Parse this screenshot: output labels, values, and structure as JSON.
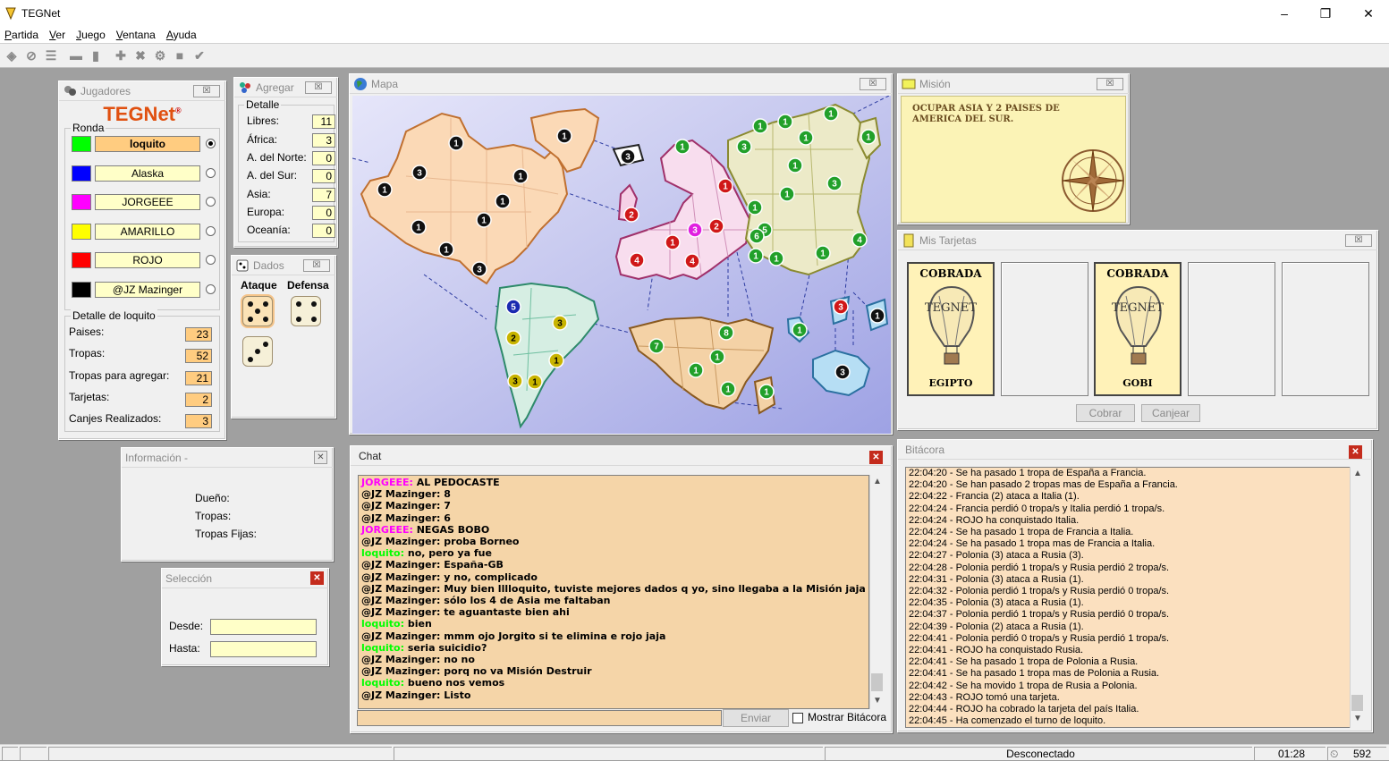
{
  "window": {
    "title": "TEGNet"
  },
  "menu": [
    "Partida",
    "Ver",
    "Juego",
    "Ventana",
    "Ayuda"
  ],
  "jugadores": {
    "title": "Jugadores",
    "logo": "TEGNet",
    "ronda_label": "Ronda",
    "players": [
      {
        "name": "loquito",
        "color": "#00ff00",
        "selected": true
      },
      {
        "name": "Alaska",
        "color": "#0000ff",
        "selected": false
      },
      {
        "name": "JORGEEE",
        "color": "#ff00ff",
        "selected": false
      },
      {
        "name": "AMARILLO",
        "color": "#ffff00",
        "selected": false
      },
      {
        "name": "ROJO",
        "color": "#ff0000",
        "selected": false
      },
      {
        "name": "@JZ Mazinger",
        "color": "#000000",
        "selected": false
      }
    ],
    "detalle_label": "Detalle de loquito",
    "detalle": [
      {
        "label": "Paises:",
        "value": "23"
      },
      {
        "label": "Tropas:",
        "value": "52"
      },
      {
        "label": "Tropas para agregar:",
        "value": "21"
      },
      {
        "label": "Tarjetas:",
        "value": "2"
      },
      {
        "label": "Canjes Realizados:",
        "value": "3"
      }
    ]
  },
  "agregar": {
    "title": "Agregar",
    "detalle_label": "Detalle",
    "rows": [
      {
        "label": "Libres:",
        "value": "11"
      },
      {
        "label": "África:",
        "value": "3"
      },
      {
        "label": "A. del Norte:",
        "value": "0"
      },
      {
        "label": "A. del Sur:",
        "value": "0"
      },
      {
        "label": "Asia:",
        "value": "7"
      },
      {
        "label": "Europa:",
        "value": "0"
      },
      {
        "label": "Oceanía:",
        "value": "0"
      }
    ]
  },
  "dados": {
    "title": "Dados",
    "ataque": "Ataque",
    "defensa": "Defensa"
  },
  "mapa": {
    "title": "Mapa"
  },
  "mision": {
    "title": "Misión",
    "text": "OCUPAR ASIA Y 2 PAISES DE AMERICA DEL SUR."
  },
  "tarjetas": {
    "title": "Mis Tarjetas",
    "cards": [
      {
        "top": "COBRADA",
        "bottom": "EGIPTO",
        "brand": "TEGNET"
      },
      {
        "top": "COBRADA",
        "bottom": "GOBI",
        "brand": "TEGNET"
      }
    ],
    "cobrar": "Cobrar",
    "canjear": "Canjear"
  },
  "informacion": {
    "title": "Información -",
    "dueno": "Dueño:",
    "tropas": "Tropas:",
    "tropas_fijas": "Tropas Fijas:"
  },
  "seleccion": {
    "title": "Selección",
    "desde": "Desde:",
    "hasta": "Hasta:"
  },
  "chat": {
    "title": "Chat",
    "enviar": "Enviar",
    "mostrar_bitacora": "Mostrar Bitácora",
    "messages": [
      {
        "user": "JORGEEE:",
        "text": " AL PEDOCASTE",
        "color": "#ff00ff"
      },
      {
        "user": "@JZ Mazinger:",
        "text": " 8",
        "color": "#000000"
      },
      {
        "user": "@JZ Mazinger:",
        "text": " 7",
        "color": "#000000"
      },
      {
        "user": "@JZ Mazinger:",
        "text": " 6",
        "color": "#000000"
      },
      {
        "user": "JORGEEE:",
        "text": " NEGAS BOBO",
        "color": "#ff00ff"
      },
      {
        "user": "@JZ Mazinger:",
        "text": " proba Borneo",
        "color": "#000000"
      },
      {
        "user": "loquito:",
        "text": " no, pero ya fue",
        "color": "#00ff00"
      },
      {
        "user": "@JZ Mazinger:",
        "text": " España-GB",
        "color": "#000000"
      },
      {
        "user": "@JZ Mazinger:",
        "text": " y no, complicado",
        "color": "#000000"
      },
      {
        "user": "@JZ Mazinger:",
        "text": " Muy bien lllloquito, tuviste mejores dados q yo, sino llegaba a la Misión jaja",
        "color": "#000000"
      },
      {
        "user": "@JZ Mazinger:",
        "text": " sólo los 4 de Asia me faltaban",
        "color": "#000000"
      },
      {
        "user": "@JZ Mazinger:",
        "text": " te aguantaste bien ahi",
        "color": "#000000"
      },
      {
        "user": "loquito:",
        "text": " bien",
        "color": "#00ff00"
      },
      {
        "user": "@JZ Mazinger:",
        "text": " mmm ojo Jorgito si te elimina e rojo jaja",
        "color": "#000000"
      },
      {
        "user": "loquito:",
        "text": " seria suicidio?",
        "color": "#00ff00"
      },
      {
        "user": "@JZ Mazinger:",
        "text": " no no",
        "color": "#000000"
      },
      {
        "user": "@JZ Mazinger:",
        "text": " porq no va Misión Destruir",
        "color": "#000000"
      },
      {
        "user": "loquito:",
        "text": " bueno nos vemos",
        "color": "#00ff00"
      },
      {
        "user": "@JZ Mazinger:",
        "text": " Listo",
        "color": "#000000"
      }
    ]
  },
  "bitacora": {
    "title": "Bitácora",
    "lines": [
      "22:04:20 - Se ha pasado 1 tropa de España a Francia.",
      "22:04:20 - Se han pasado 2 tropas mas de España a Francia.",
      "22:04:22 - Francia (2) ataca a Italia (1).",
      "22:04:24 - Francia perdió 0 tropa/s y Italia perdió 1 tropa/s.",
      "22:04:24 - ROJO ha conquistado Italia.",
      "22:04:24 - Se ha pasado 1 tropa de Francia a Italia.",
      "22:04:24 - Se ha pasado 1 tropa mas de Francia a Italia.",
      "22:04:27 - Polonia (3) ataca a Rusia (3).",
      "22:04:28 - Polonia perdió 1 tropa/s y Rusia perdió 2 tropa/s.",
      "22:04:31 - Polonia (3) ataca a Rusia (1).",
      "22:04:32 - Polonia perdió 1 tropa/s y Rusia perdió 0 tropa/s.",
      "22:04:35 - Polonia (3) ataca a Rusia (1).",
      "22:04:37 - Polonia perdió 1 tropa/s y Rusia perdió 0 tropa/s.",
      "22:04:39 - Polonia (2) ataca a Rusia (1).",
      "22:04:41 - Polonia perdió 0 tropa/s y Rusia perdió 1 tropa/s.",
      "22:04:41 - ROJO ha conquistado Rusia.",
      "22:04:41 - Se ha pasado 1 tropa de Polonia a Rusia.",
      "22:04:41 - Se ha pasado 1 tropa mas de Polonia a Rusia.",
      "22:04:42 - Se ha movido 1 tropa de Rusia a Polonia.",
      "22:04:43 - ROJO tomó una tarjeta.",
      "22:04:44 - ROJO ha cobrado la tarjeta del país Italia.",
      "22:04:45 - Ha comenzado el turno de loquito."
    ]
  },
  "status": {
    "conexion": "Desconectado",
    "time": "01:28",
    "ping": "592"
  },
  "map_armies": [
    {
      "n": "1",
      "c": "black"
    },
    {
      "n": "1",
      "c": "black"
    },
    {
      "n": "3",
      "c": "black"
    },
    {
      "n": "1",
      "c": "black"
    },
    {
      "n": "1",
      "c": "black"
    },
    {
      "n": "1",
      "c": "black"
    },
    {
      "n": "1",
      "c": "black"
    },
    {
      "n": "1",
      "c": "black"
    },
    {
      "n": "1",
      "c": "black"
    },
    {
      "n": "3",
      "c": "black"
    },
    {
      "n": "3",
      "c": "black"
    },
    {
      "n": "2",
      "c": "red"
    },
    {
      "n": "1",
      "c": "green"
    },
    {
      "n": "1",
      "c": "red"
    },
    {
      "n": "2",
      "c": "red"
    },
    {
      "n": "3",
      "c": "magenta"
    },
    {
      "n": "1",
      "c": "red"
    },
    {
      "n": "4",
      "c": "red"
    },
    {
      "n": "4",
      "c": "red"
    },
    {
      "n": "1",
      "c": "green"
    },
    {
      "n": "1",
      "c": "green"
    },
    {
      "n": "1",
      "c": "green"
    },
    {
      "n": "1",
      "c": "green"
    },
    {
      "n": "1",
      "c": "green"
    },
    {
      "n": "3",
      "c": "green"
    },
    {
      "n": "1",
      "c": "green"
    },
    {
      "n": "1",
      "c": "green"
    },
    {
      "n": "3",
      "c": "green"
    },
    {
      "n": "1",
      "c": "green"
    },
    {
      "n": "5",
      "c": "green"
    },
    {
      "n": "6",
      "c": "green"
    },
    {
      "n": "1",
      "c": "green"
    },
    {
      "n": "1",
      "c": "green"
    },
    {
      "n": "1",
      "c": "green"
    },
    {
      "n": "4",
      "c": "green"
    },
    {
      "n": "5",
      "c": "blue"
    },
    {
      "n": "3",
      "c": "yellow"
    },
    {
      "n": "2",
      "c": "yellow"
    },
    {
      "n": "1",
      "c": "yellow"
    },
    {
      "n": "3",
      "c": "yellow"
    },
    {
      "n": "1",
      "c": "yellow"
    },
    {
      "n": "7",
      "c": "green"
    },
    {
      "n": "8",
      "c": "green"
    },
    {
      "n": "1",
      "c": "green"
    },
    {
      "n": "1",
      "c": "green"
    },
    {
      "n": "1",
      "c": "green"
    },
    {
      "n": "1",
      "c": "green"
    },
    {
      "n": "1",
      "c": "green"
    },
    {
      "n": "3",
      "c": "red"
    },
    {
      "n": "1",
      "c": "black"
    },
    {
      "n": "3",
      "c": "black"
    }
  ]
}
